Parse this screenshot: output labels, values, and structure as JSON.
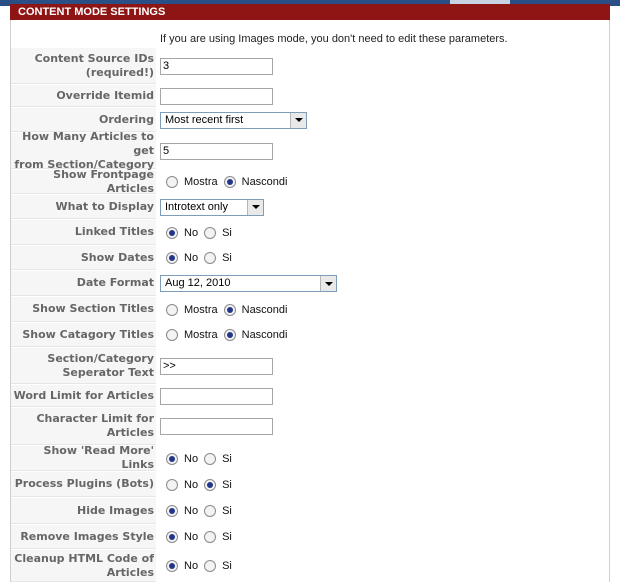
{
  "header": {
    "title": "CONTENT MODE SETTINGS"
  },
  "note": "If you are using Images mode, you don't need to edit these parameters.",
  "fields": [
    {
      "label_lines": [
        "Content Source IDs",
        "(required!)"
      ],
      "type": "text",
      "value": "3"
    },
    {
      "label_lines": [
        "Override Itemid"
      ],
      "type": "text",
      "value": ""
    },
    {
      "label_lines": [
        "Ordering"
      ],
      "type": "select",
      "value": "Most recent first"
    },
    {
      "label_lines": [
        "How Many Articles to get",
        "from Section/Category"
      ],
      "type": "text",
      "value": "5"
    },
    {
      "label_lines": [
        "Show Frontpage Articles"
      ],
      "type": "radio",
      "options": [
        "Mostra",
        "Nascondi"
      ],
      "selected": "Nascondi"
    },
    {
      "label_lines": [
        "What to Display"
      ],
      "type": "select",
      "value": "Introtext only"
    },
    {
      "label_lines": [
        "Linked Titles"
      ],
      "type": "radio",
      "options": [
        "No",
        "Si"
      ],
      "selected": "No"
    },
    {
      "label_lines": [
        "Show Dates"
      ],
      "type": "radio",
      "options": [
        "No",
        "Si"
      ],
      "selected": "No"
    },
    {
      "label_lines": [
        "Date Format"
      ],
      "type": "select",
      "value": "Aug 12, 2010"
    },
    {
      "label_lines": [
        "Show Section Titles"
      ],
      "type": "radio",
      "options": [
        "Mostra",
        "Nascondi"
      ],
      "selected": "Nascondi"
    },
    {
      "label_lines": [
        "Show Catagory Titles"
      ],
      "type": "radio",
      "options": [
        "Mostra",
        "Nascondi"
      ],
      "selected": "Nascondi"
    },
    {
      "label_lines": [
        "Section/Category",
        "Seperator Text"
      ],
      "type": "text",
      "value": ">>"
    },
    {
      "label_lines": [
        "Word Limit for Articles"
      ],
      "type": "text",
      "value": ""
    },
    {
      "label_lines": [
        "Character Limit for",
        "Articles"
      ],
      "type": "text",
      "value": ""
    },
    {
      "label_lines": [
        "Show 'Read More' Links"
      ],
      "type": "radio",
      "options": [
        "No",
        "Si"
      ],
      "selected": "No"
    },
    {
      "label_lines": [
        "Process Plugins (Bots)"
      ],
      "type": "radio",
      "options": [
        "No",
        "Si"
      ],
      "selected": "Si"
    },
    {
      "label_lines": [
        "Hide Images"
      ],
      "type": "radio",
      "options": [
        "No",
        "Si"
      ],
      "selected": "No"
    },
    {
      "label_lines": [
        "Remove Images Style"
      ],
      "type": "radio",
      "options": [
        "No",
        "Si"
      ],
      "selected": "No"
    },
    {
      "label_lines": [
        "Cleanup HTML Code of",
        "Articles"
      ],
      "type": "radio",
      "options": [
        "No",
        "Si"
      ],
      "selected": "No"
    }
  ]
}
